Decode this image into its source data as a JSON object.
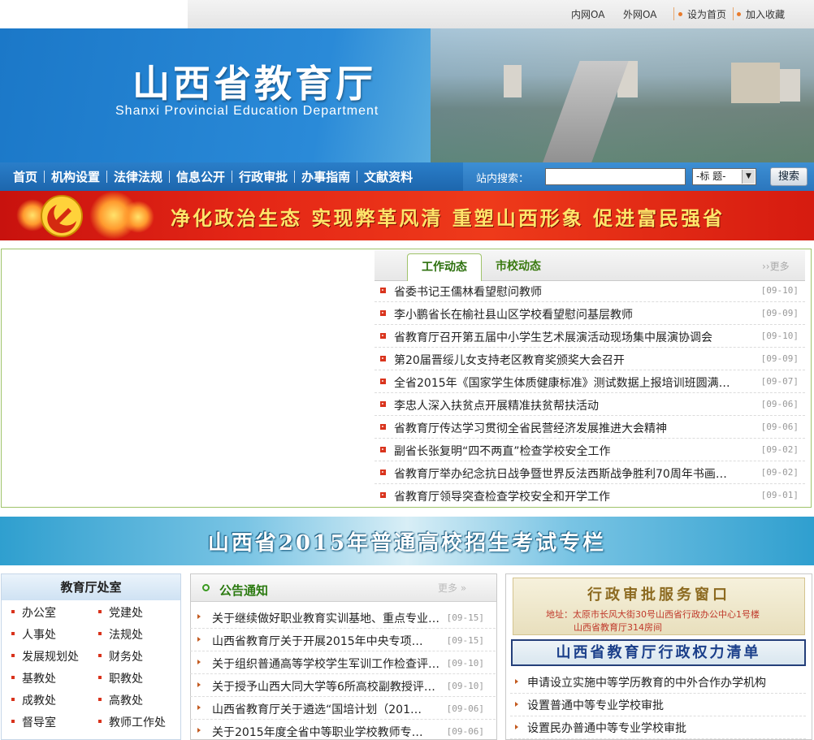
{
  "topbar": {
    "links": [
      "内网OA",
      "外网OA",
      "设为首页",
      "加入收藏"
    ]
  },
  "banner": {
    "title_cn": "山西省教育厅",
    "title_en": "Shanxi Provincial Education Department"
  },
  "nav": {
    "items": [
      "首页",
      "机构设置",
      "法律法规",
      "信息公开",
      "行政审批",
      "办事指南",
      "文献资料"
    ],
    "search_label": "站内搜索：",
    "search_value": "",
    "search_option": "-标  题-",
    "search_button": "搜索"
  },
  "slogan": {
    "text": "净化政治生态 实现弊革风清 重塑山西形象 促进富民强省"
  },
  "news": {
    "tab_active": "工作动态",
    "tab_other": "市校动态",
    "more": "更多",
    "items": [
      {
        "title": "省委书记王儒林看望慰问教师",
        "date": "[09-10]"
      },
      {
        "title": "李小鹏省长在榆社县山区学校看望慰问基层教师",
        "date": "[09-09]"
      },
      {
        "title": "省教育厅召开第五届中小学生艺术展演活动现场集中展演协调会",
        "date": "[09-10]"
      },
      {
        "title": "第20届晋绥儿女支持老区教育奖颁奖大会召开",
        "date": "[09-09]"
      },
      {
        "title": "全省2015年《国家学生体质健康标准》测试数据上报培训班圆满…",
        "date": "[09-07]"
      },
      {
        "title": "李忠人深入扶贫点开展精准扶贫帮扶活动",
        "date": "[09-06]"
      },
      {
        "title": "省教育厅传达学习贯彻全省民营经济发展推进大会精神",
        "date": "[09-06]"
      },
      {
        "title": "副省长张复明“四不两直”检查学校安全工作",
        "date": "[09-02]"
      },
      {
        "title": "省教育厅举办纪念抗日战争暨世界反法西斯战争胜利70周年书画摄…",
        "date": "[09-02]"
      },
      {
        "title": "省教育厅领导突查检查学校安全和开学工作",
        "date": "[09-01]"
      }
    ]
  },
  "exam_banner": {
    "text": "山西省2015年普通高校招生考试专栏"
  },
  "departments": {
    "title": "教育厅处室",
    "col1": [
      "办公室",
      "人事处",
      "发展规划处",
      "基教处",
      "成教处",
      "督导室"
    ],
    "col2": [
      "党建处",
      "法规处",
      "财务处",
      "职教处",
      "高教处",
      "教师工作处"
    ]
  },
  "notice": {
    "title": "公告通知",
    "more": "更多",
    "items": [
      {
        "title": "关于继续做好职业教育实训基地、重点专业…",
        "date": "[09-15]"
      },
      {
        "title": "山西省教育厅关于开展2015年中央专项…",
        "date": "[09-15]"
      },
      {
        "title": "关于组织普通高等学校学生军训工作检查评…",
        "date": "[09-10]"
      },
      {
        "title": "关于授予山西大同大学等6所高校副教授评…",
        "date": "[09-10]"
      },
      {
        "title": "山西省教育厅关于遴选“国培计划（201…",
        "date": "[09-06]"
      },
      {
        "title": "关于2015年度全省中等职业学校教师专…",
        "date": "[09-06]"
      }
    ]
  },
  "admin": {
    "window_title": "行政审批服务窗口",
    "address": "地址：太原市长风大街30号山西省行政办公中心1号楼",
    "room": "山西省教育厅314房间",
    "power_list": "山西省教育厅行政权力清单",
    "items": [
      "申请设立实施中等学历教育的中外合作办学机构",
      "设置普通中等专业学校审批",
      "设置民办普通中等专业学校审批"
    ]
  }
}
